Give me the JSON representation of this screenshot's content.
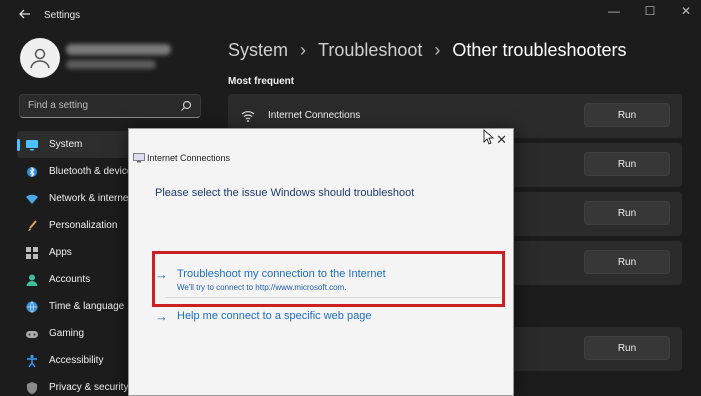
{
  "window": {
    "title": "Settings",
    "controls": [
      "—",
      "☐",
      "✕"
    ]
  },
  "sidebar": {
    "search_placeholder": "Find a setting",
    "items": [
      {
        "label": "System",
        "icon": "monitor-icon",
        "active": true
      },
      {
        "label": "Bluetooth & devices",
        "icon": "bluetooth-icon"
      },
      {
        "label": "Network & internet",
        "icon": "network-icon"
      },
      {
        "label": "Personalization",
        "icon": "brush-icon"
      },
      {
        "label": "Apps",
        "icon": "apps-icon"
      },
      {
        "label": "Accounts",
        "icon": "person-icon"
      },
      {
        "label": "Time & language",
        "icon": "globe-icon"
      },
      {
        "label": "Gaming",
        "icon": "gamepad-icon"
      },
      {
        "label": "Accessibility",
        "icon": "accessibility-icon"
      },
      {
        "label": "Privacy & security",
        "icon": "shield-icon"
      }
    ]
  },
  "main": {
    "breadcrumb": [
      "System",
      "Troubleshoot",
      "Other troubleshooters"
    ],
    "section_label": "Most frequent",
    "cards": [
      {
        "label": "Internet Connections",
        "button": "Run"
      },
      {
        "label": "",
        "button": "Run"
      },
      {
        "label": "",
        "button": "Run"
      },
      {
        "label": "",
        "button": "Run"
      },
      {
        "label": "",
        "button": "Run"
      }
    ]
  },
  "dialog": {
    "title": "Internet Connections",
    "question": "Please select the issue Windows should troubleshoot",
    "options": [
      {
        "title": "Troubleshoot my connection to the Internet",
        "description": "We'll try to connect to http://www.microsoft.com."
      },
      {
        "title": "Help me connect to a specific web page",
        "description": ""
      }
    ],
    "close": "✕"
  },
  "colors": {
    "accent": "#4cc2ff",
    "highlight": "#cc1f24",
    "link": "#1f6fc0"
  }
}
